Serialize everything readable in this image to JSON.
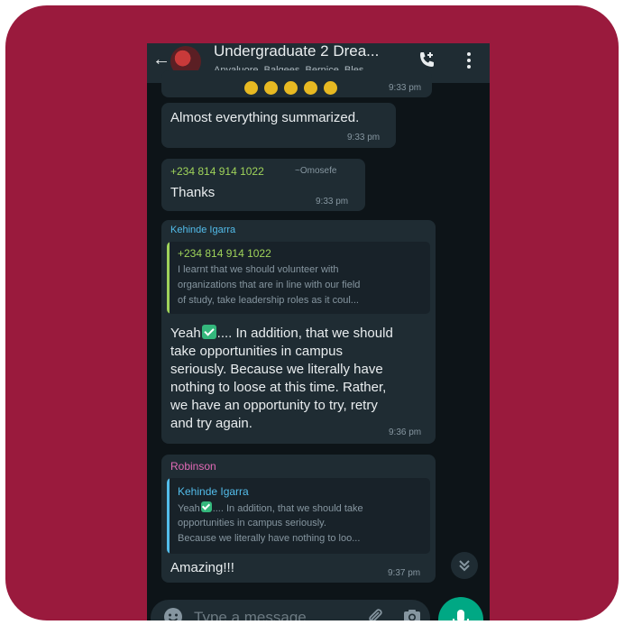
{
  "header": {
    "title": "Undergraduate 2 Drea...",
    "subtitle": "Anyaluore, Balqees, Bernice, Bles..."
  },
  "messages": [
    {
      "time": "9:33 pm",
      "text": "Almost everything summarized."
    },
    {
      "sender_phone": "+234 814 914 1022",
      "sender_name": "~Omosefe",
      "text": "Thanks",
      "time": "9:33 pm"
    },
    {
      "sender": "Kehinde Igarra",
      "quote": {
        "author": "+234 814 914 1022",
        "lines": [
          "I learnt that we should volunteer with",
          "organizations that are in line with our field",
          "of study, take leadership roles as it coul..."
        ]
      },
      "text_first": "Yeah",
      "text_after_check": ".... In addition, that we should",
      "lines": [
        "take opportunities in campus",
        "seriously. Because we literally have",
        "nothing to loose at this time. Rather,",
        "we have an opportunity to try, retry",
        "and try again."
      ],
      "time": "9:36 pm"
    },
    {
      "sender": "Robinson",
      "quote": {
        "author": "Kehinde Igarra",
        "line1_start": "Yeah",
        "line1_rest": ".... In addition, that we should take",
        "lines": [
          "opportunities in campus seriously.",
          "Because we literally have nothing to loo..."
        ]
      },
      "text": "Amazing!!!",
      "time": "9:37 pm"
    }
  ],
  "top_partial_time": "9:33 pm",
  "input": {
    "placeholder": "Type a message"
  },
  "colors": {
    "background": "#9a1a3d",
    "chat_bg": "#0d1418",
    "bubble": "#1f2c33",
    "sender_green": "#9fd35a",
    "sender_blue": "#53bdeb",
    "sender_pink": "#e26ab6",
    "mic_button": "#00a884"
  }
}
